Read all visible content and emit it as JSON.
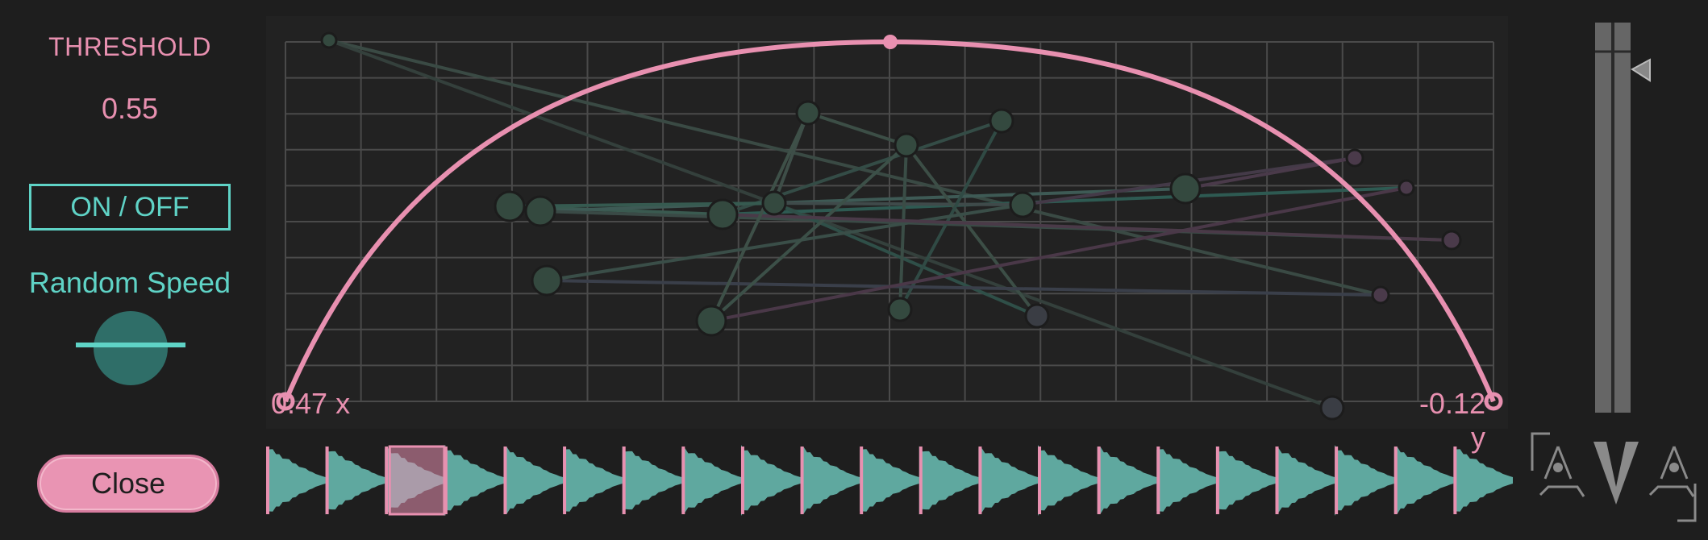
{
  "threshold": {
    "title": "THRESHOLD",
    "value": "0.55"
  },
  "toggle": {
    "label": "ON / OFF"
  },
  "random_speed": {
    "label": "Random Speed",
    "level": 0.5
  },
  "close_button": {
    "label": "Close"
  },
  "pad": {
    "left_readout": "0.47 x",
    "right_readout": "-0.12 y"
  },
  "meter": {
    "level_fraction": 0.13
  },
  "waveform": {
    "segment_count": 21,
    "highlighted_index": 2
  },
  "colors": {
    "accent_pink": "#e890b0",
    "accent_teal": "#5fd3c6",
    "waveform_teal": "#5fa89f",
    "background": "#1e1e1e",
    "pad_background": "#232323",
    "grid": "#4a4a4a",
    "node_green": "#34493f",
    "node_gray": "#3a3a3e",
    "node_plum": "#3e3440",
    "meter_bar": "#666666"
  },
  "icons": {
    "logo": "ava-logo-icon",
    "meter_pointer": "triangle-left-icon",
    "knob": "random-speed-knob-icon"
  }
}
